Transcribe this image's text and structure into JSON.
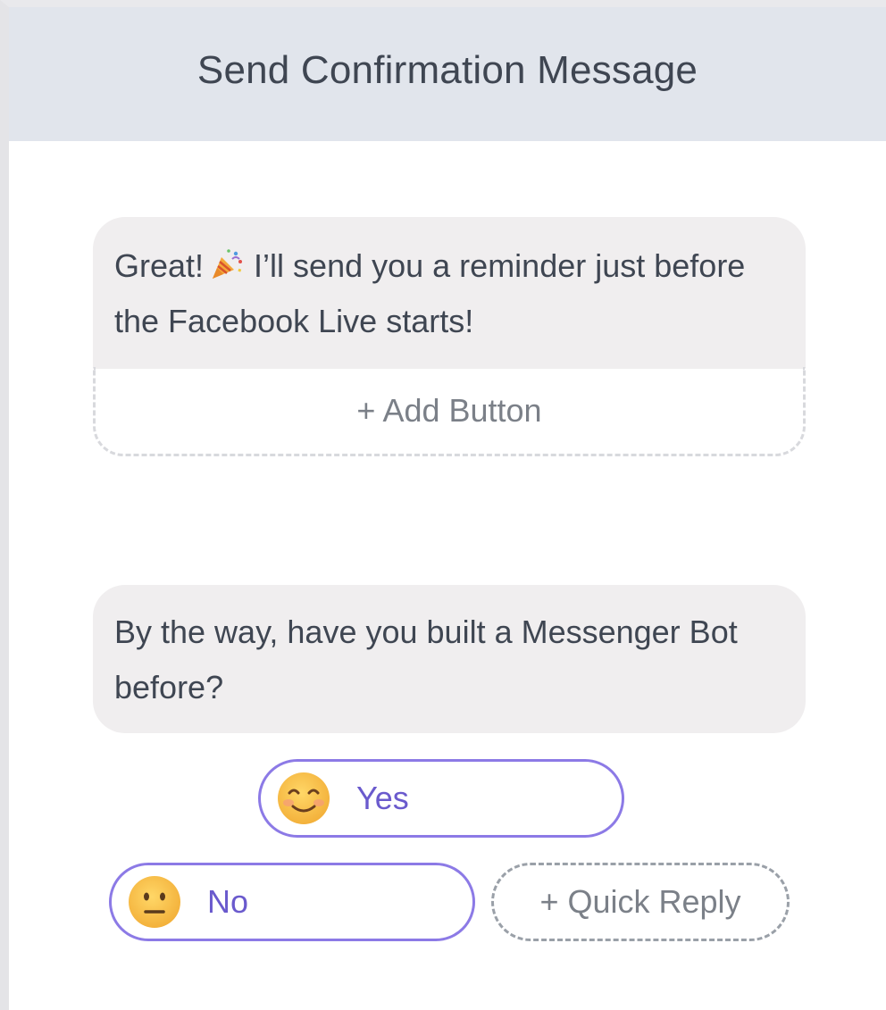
{
  "header": {
    "title": "Send Confirmation Message"
  },
  "messages": [
    {
      "text_before_emoji": "Great!",
      "emoji": "party-popper-icon",
      "text_after_emoji": "I’ll send you a reminder just before the Facebook Live starts!",
      "add_button_label": "+ Add Button"
    },
    {
      "text": "By the way, have you built a Messenger Bot before?"
    }
  ],
  "quick_replies": [
    {
      "label": "Yes",
      "emoji": "smiling-face-icon"
    },
    {
      "label": "No",
      "emoji": "neutral-face-icon"
    }
  ],
  "add_quick_reply_label": "+ Quick Reply",
  "colors": {
    "header_bg": "#e1e5ec",
    "bubble_bg": "#f0eeef",
    "quick_reply_border": "#8c7ae6",
    "quick_reply_text": "#6a5acd",
    "text": "#3f4652",
    "muted_text": "#7b8088"
  }
}
